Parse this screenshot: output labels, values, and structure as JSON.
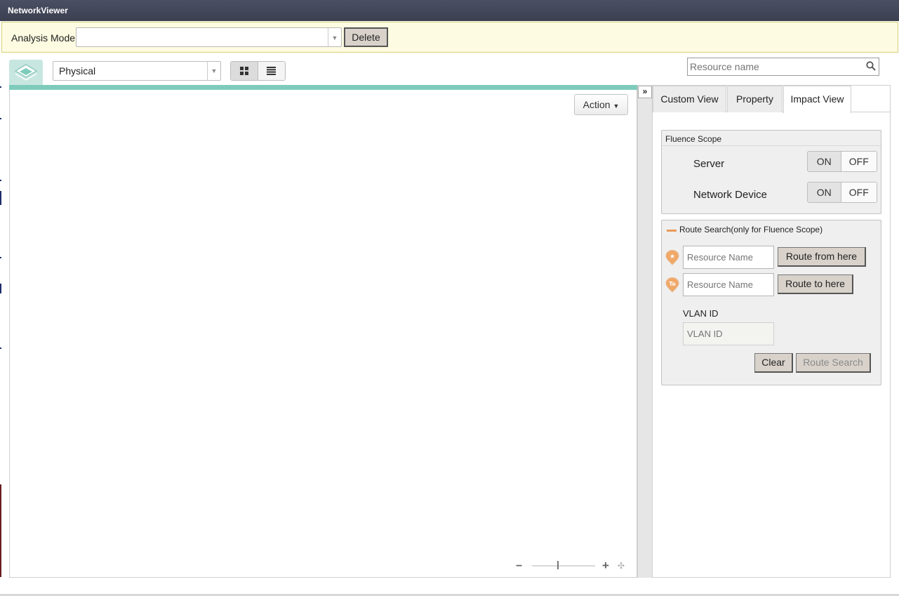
{
  "window": {
    "title": "NetworkViewer"
  },
  "analysis": {
    "label": "Analysis Mode",
    "selected": "",
    "delete_label": "Delete"
  },
  "toolbar": {
    "layer_select": "Physical",
    "view_modes": [
      "grid-view-icon",
      "list-view-icon"
    ],
    "search_placeholder": "Resource name"
  },
  "canvas": {
    "action_label": "Action"
  },
  "panel": {
    "collapse_glyph": "»",
    "tabs": [
      {
        "label": "Custom View",
        "active": false
      },
      {
        "label": "Property",
        "active": false
      },
      {
        "label": "Impact View",
        "active": true
      }
    ],
    "fluence": {
      "title": "Fluence Scope",
      "rows": [
        {
          "label": "Server",
          "on": "ON",
          "off": "OFF",
          "state": "ON"
        },
        {
          "label": "Network Device",
          "on": "ON",
          "off": "OFF",
          "state": "ON"
        }
      ]
    },
    "route": {
      "title": "Route Search(only for Fluence Scope)",
      "from_placeholder": "Resource Name",
      "from_button": "Route from here",
      "from_pin": "★",
      "to_placeholder": "Resource Name",
      "to_button": "Route to here",
      "to_pin": "To",
      "vlan_label": "VLAN ID",
      "vlan_placeholder": "VLAN ID",
      "clear_label": "Clear",
      "search_label": "Route Search"
    }
  },
  "colors": {
    "title_bar": "#3f4356",
    "analysis_bg": "#fdfbe1",
    "canvas_accent": "#7ecbbc",
    "pin_orange": "#f0a868",
    "button_bg": "#d8d2cb"
  }
}
